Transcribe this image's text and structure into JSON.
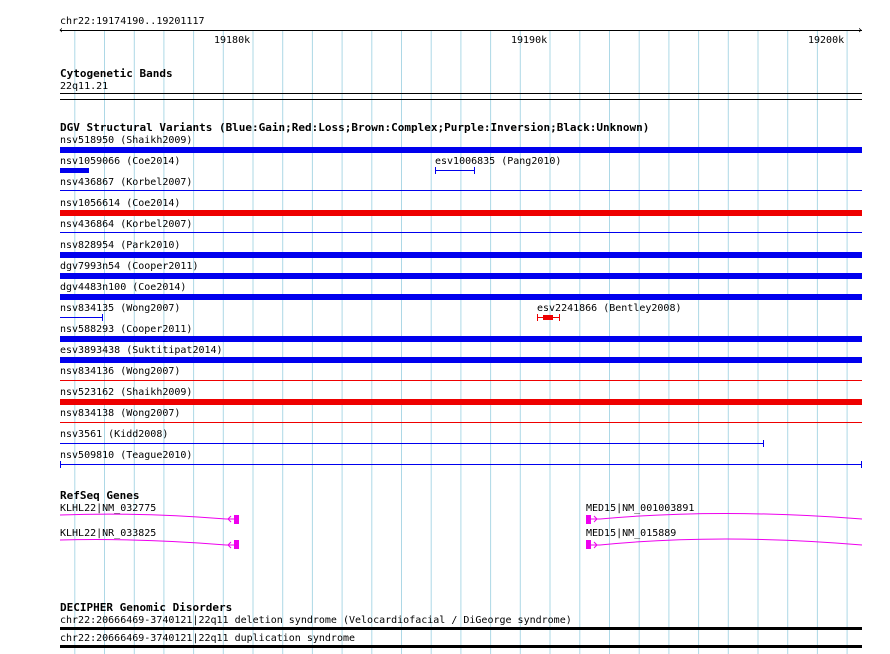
{
  "region": "chr22:19174190..19201117",
  "ruler": {
    "ticks": [
      "19180k",
      "19190k",
      "19200k"
    ]
  },
  "cytoband": {
    "title": "Cytogenetic Bands",
    "band": "22q11.21"
  },
  "dgv": {
    "title": "DGV Structural Variants (Blue:Gain;Red:Loss;Brown:Complex;Purple:Inversion;Black:Unknown)",
    "variants": [
      {
        "label": "nsv518950 (Shaikh2009)",
        "color": "#0000ee",
        "style": "thick"
      },
      {
        "label": "nsv1059066 (Coe2014)",
        "color": "#0000ee",
        "style": "thick-short"
      },
      {
        "label": "esv1006835 (Pang2010)",
        "color": "#0000ee",
        "style": "thin-capped"
      },
      {
        "label": "nsv436867 (Korbel2007)",
        "color": "#0000ee",
        "style": "thin"
      },
      {
        "label": "nsv1056614 (Coe2014)",
        "color": "#ee0000",
        "style": "thick"
      },
      {
        "label": "nsv436864 (Korbel2007)",
        "color": "#0000ee",
        "style": "thin"
      },
      {
        "label": "nsv828954 (Park2010)",
        "color": "#0000ee",
        "style": "thick"
      },
      {
        "label": "dgv7993n54 (Cooper2011)",
        "color": "#0000ee",
        "style": "thick"
      },
      {
        "label": "dgv4483n100 (Coe2014)",
        "color": "#0000ee",
        "style": "thick"
      },
      {
        "label": "nsv834135 (Wong2007)",
        "color": "#0000ee",
        "style": "thin-capped"
      },
      {
        "label": "esv2241866 (Bentley2008)",
        "color": "#ee0000",
        "style": "capped-box"
      },
      {
        "label": "nsv588293 (Cooper2011)",
        "color": "#0000ee",
        "style": "thick"
      },
      {
        "label": "esv3893438 (Suktitipat2014)",
        "color": "#0000ee",
        "style": "thick"
      },
      {
        "label": "nsv834136 (Wong2007)",
        "color": "#ee0000",
        "style": "thin"
      },
      {
        "label": "nsv523162 (Shaikh2009)",
        "color": "#ee0000",
        "style": "thick"
      },
      {
        "label": "nsv834138 (Wong2007)",
        "color": "#ee0000",
        "style": "thin"
      },
      {
        "label": "nsv3561 (Kidd2008)",
        "color": "#0000ee",
        "style": "thin-capped"
      },
      {
        "label": "nsv509810 (Teague2010)",
        "color": "#0000ee",
        "style": "thin-capped"
      }
    ]
  },
  "refseq": {
    "title": "RefSeq Genes",
    "genes": [
      {
        "label": "KLHL22|NM_032775",
        "color": "#ee00ee",
        "strand": "-"
      },
      {
        "label": "KLHL22|NR_033825",
        "color": "#ee00ee",
        "strand": "-"
      },
      {
        "label": "MED15|NM_001003891",
        "color": "#ee00ee",
        "strand": "+"
      },
      {
        "label": "MED15|NM_015889",
        "color": "#ee00ee",
        "strand": "+"
      }
    ]
  },
  "decipher": {
    "title": "DECIPHER Genomic Disorders",
    "items": [
      {
        "label": "chr22:20666469-3740121|22q11 deletion syndrome (Velocardiofacial / DiGeorge syndrome)"
      },
      {
        "label": "chr22:20666469-3740121|22q11 duplication syndrome"
      }
    ]
  },
  "colors": {
    "grid": "#add8e6",
    "gain": "#0000ee",
    "loss": "#ee0000",
    "gene": "#ee00ee"
  }
}
